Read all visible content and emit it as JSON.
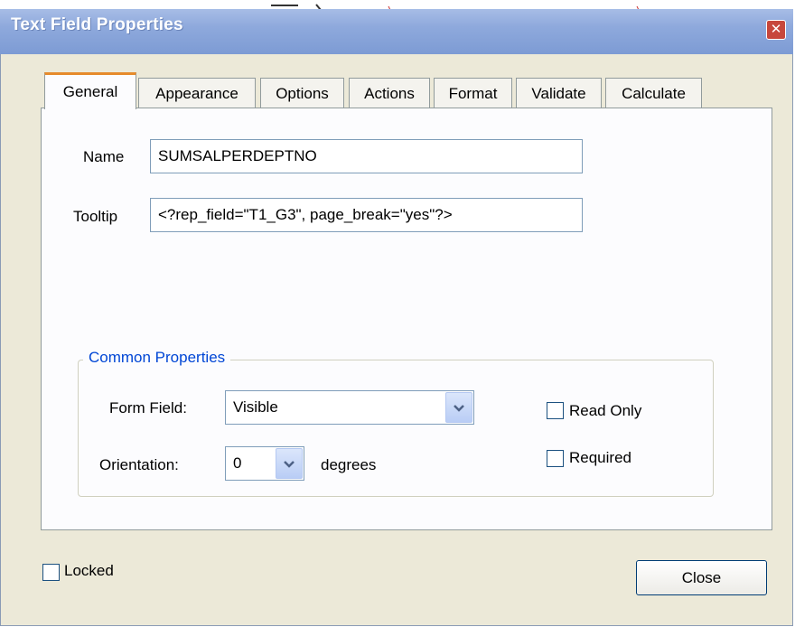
{
  "window": {
    "title": "Text Field Properties",
    "close_glyph": "✕"
  },
  "tabs": [
    {
      "label": "General"
    },
    {
      "label": "Appearance"
    },
    {
      "label": "Options"
    },
    {
      "label": "Actions"
    },
    {
      "label": "Format"
    },
    {
      "label": "Validate"
    },
    {
      "label": "Calculate"
    }
  ],
  "general": {
    "name_label": "Name",
    "name_value": "SUMSALPERDEPTNO",
    "tooltip_label": "Tooltip",
    "tooltip_value": "<?rep_field=\"T1_G3\", page_break=\"yes\"?>"
  },
  "common": {
    "legend": "Common Properties",
    "form_field_label": "Form Field:",
    "form_field_value": "Visible",
    "orientation_label": "Orientation:",
    "orientation_value": "0",
    "degrees_label": "degrees",
    "read_only_label": "Read Only",
    "required_label": "Required"
  },
  "footer": {
    "locked_label": "Locked",
    "close_label": "Close"
  },
  "colors": {
    "title_bar": "#7d9bd4",
    "accent_tab": "#e68b2c",
    "legend_text": "#0046d5"
  }
}
